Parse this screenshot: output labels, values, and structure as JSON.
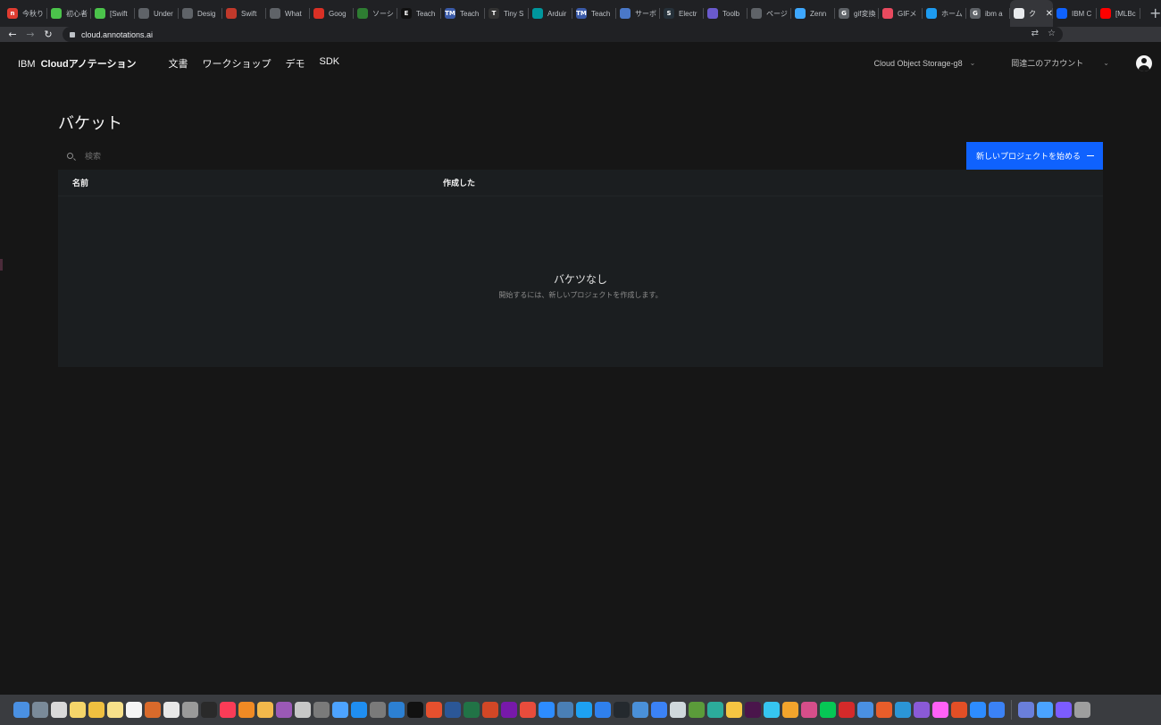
{
  "browser": {
    "tabs": [
      {
        "title": "今秋り",
        "color": "#e03c31",
        "glyph": "n"
      },
      {
        "title": "初心者",
        "color": "#4bc34b",
        "glyph": ""
      },
      {
        "title": "[Swift",
        "color": "#4bc34b",
        "glyph": ""
      },
      {
        "title": "Under",
        "color": "#5f6368",
        "glyph": ""
      },
      {
        "title": "Desig",
        "color": "#5f6368",
        "glyph": ""
      },
      {
        "title": "Swift",
        "color": "#c0392b",
        "glyph": ""
      },
      {
        "title": "What",
        "color": "#5f6368",
        "glyph": ""
      },
      {
        "title": "Goog",
        "color": "#d93025",
        "glyph": ""
      },
      {
        "title": "ソーシ",
        "color": "#2e7d32",
        "glyph": ""
      },
      {
        "title": "Teach",
        "color": "#111111",
        "glyph": "E"
      },
      {
        "title": "Teach",
        "color": "#3b5ba9",
        "glyph": "TM"
      },
      {
        "title": "Tiny S",
        "color": "#333333",
        "glyph": "T"
      },
      {
        "title": "Arduir",
        "color": "#00979d",
        "glyph": ""
      },
      {
        "title": "Teach",
        "color": "#3b5ba9",
        "glyph": "TM"
      },
      {
        "title": "サーボ",
        "color": "#4a78c8",
        "glyph": ""
      },
      {
        "title": "Electr",
        "color": "#26313a",
        "glyph": "S"
      },
      {
        "title": "Toolb",
        "color": "#6a5acd",
        "glyph": ""
      },
      {
        "title": "ページ",
        "color": "#5f6368",
        "glyph": ""
      },
      {
        "title": "Zenn",
        "color": "#3ea8ff",
        "glyph": ""
      },
      {
        "title": "gif変換",
        "color": "#5f6368",
        "glyph": "G"
      },
      {
        "title": "GIFメ",
        "color": "#e84a5f",
        "glyph": ""
      },
      {
        "title": "ホーム",
        "color": "#1d9bf0",
        "glyph": ""
      },
      {
        "title": "ibm a",
        "color": "#5f6368",
        "glyph": "G"
      },
      {
        "title": "ク",
        "color": "#e8eaed",
        "glyph": ""
      },
      {
        "title": "IBM C",
        "color": "#0f62fe",
        "glyph": ""
      },
      {
        "title": "[MLBc",
        "color": "#ff0000",
        "glyph": ""
      }
    ],
    "active_tab_index": 23,
    "url": "cloud.annotations.ai"
  },
  "header": {
    "brand_prefix": "IBM",
    "brand_name": "Cloudアノテーション",
    "nav": [
      "文書",
      "ワークショップ",
      "デモ",
      "SDK"
    ],
    "storage_select": "Cloud Object Storage-g8",
    "account_select": "岡達二のアカウント"
  },
  "page": {
    "title": "バケット",
    "search_placeholder": "検索",
    "primary_button": "新しいプロジェクトを始める",
    "columns": [
      "名前",
      "作成した"
    ],
    "empty_title": "バケツなし",
    "empty_subtitle": "開始するには、新しいプロジェクトを作成します。"
  },
  "dock": {
    "colors": [
      "#4a90e2",
      "#7a8a99",
      "#d9d9d9",
      "#f5d56a",
      "#f0c040",
      "#f7e08a",
      "#f5f5f5",
      "#d96a2b",
      "#e8e8e8",
      "#9a9a9a",
      "#2a2a2a",
      "#fa3c57",
      "#f08a24",
      "#f2b84b",
      "#9b59b6",
      "#c7c7c7",
      "#7a7a7a",
      "#4da3ff",
      "#1f8ef1",
      "#7a7a7a",
      "#2c80d3",
      "#111111",
      "#e6502e",
      "#2b5797",
      "#217346",
      "#d24726",
      "#7719aa",
      "#e74c3c",
      "#2d8cff",
      "#4a7fb5",
      "#1da1f2",
      "#2f80ed",
      "#24292e",
      "#4a90d9",
      "#3b82f6",
      "#cfd8dc",
      "#5b9b3a",
      "#2cab9b",
      "#f5c542",
      "#4a154b",
      "#36c5f0",
      "#f3a42c",
      "#d64e8a",
      "#06c755",
      "#d42a2a",
      "#4a90e2",
      "#e85d2a",
      "#2b95d6",
      "#8a5ad7",
      "#ff61f6",
      "#e34f26",
      "#2d8cff",
      "#3b82f6",
      "#6a7fdb",
      "#4aa3ff",
      "#7c5cff",
      "#9e9e9e"
    ]
  }
}
